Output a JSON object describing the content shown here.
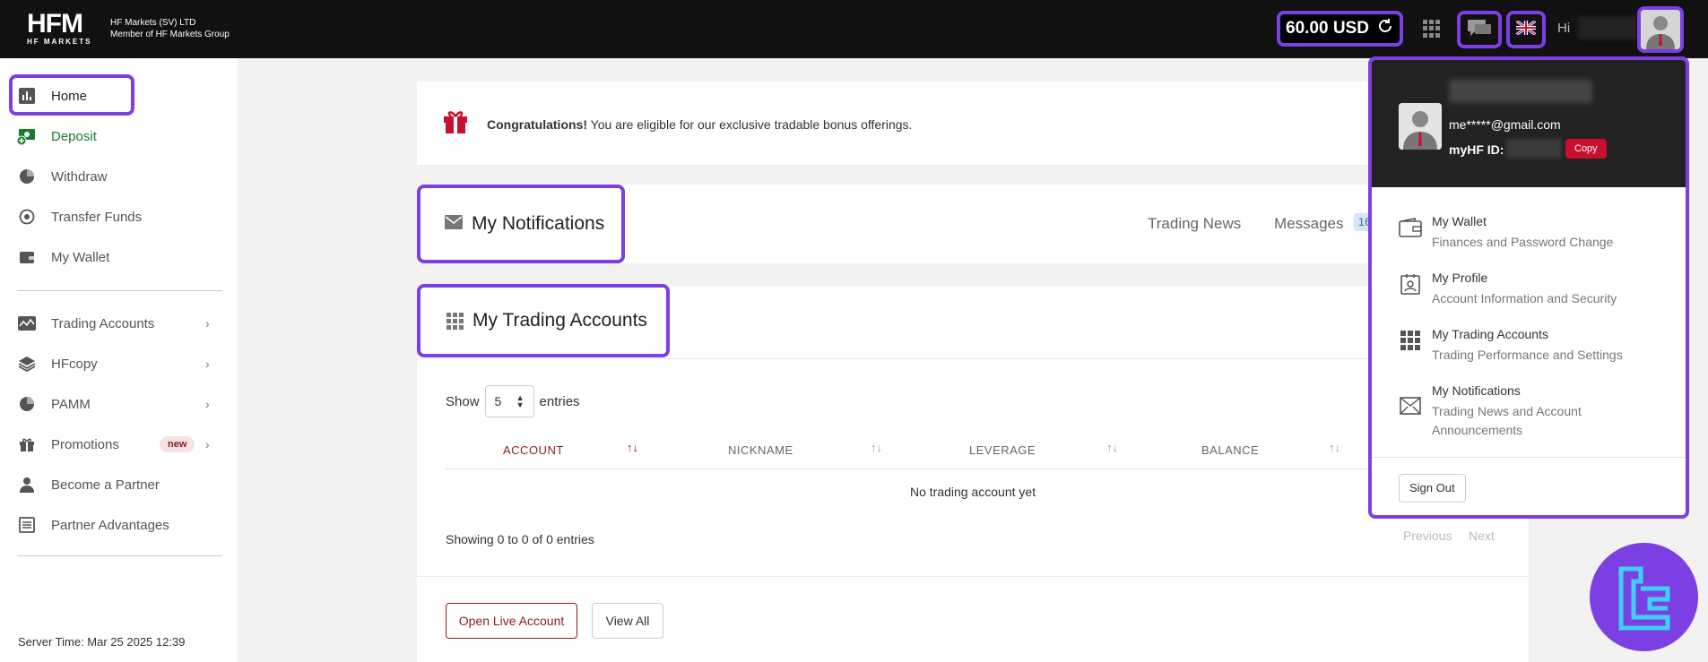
{
  "topbar": {
    "logo_text": "HFM",
    "logo_sub": "HF MARKETS",
    "company_line1": "HF Markets (SV) LTD",
    "company_line2": "Member of HF Markets Group",
    "balance": "60.00 USD",
    "greeting": "Hi"
  },
  "sidebar": {
    "items": [
      {
        "label": "Home"
      },
      {
        "label": "Deposit"
      },
      {
        "label": "Withdraw"
      },
      {
        "label": "Transfer Funds"
      },
      {
        "label": "My Wallet"
      },
      {
        "label": "Trading Accounts"
      },
      {
        "label": "HFcopy"
      },
      {
        "label": "PAMM"
      },
      {
        "label": "Promotions",
        "badge": "new"
      },
      {
        "label": "Become a Partner"
      },
      {
        "label": "Partner Advantages"
      }
    ],
    "server_time": "Server Time: Mar 25 2025 12:39"
  },
  "congrats": {
    "bold": "Congratulations!",
    "text": " You are eligible for our exclusive tradable bonus offerings."
  },
  "notifications": {
    "title": "My Notifications",
    "tab_news": "Trading News",
    "tab_messages": "Messages",
    "messages_count": "16"
  },
  "trading": {
    "title": "My Trading Accounts",
    "show_label": "Show",
    "entries_value": "5",
    "entries_label": "entries",
    "columns": [
      "ACCOUNT",
      "NICKNAME",
      "LEVERAGE",
      "BALANCE"
    ],
    "empty_text": "No trading account yet",
    "showing": "Showing 0 to 0 of 0 entries",
    "previous": "Previous",
    "next": "Next",
    "open_live": "Open Live Account",
    "view_all": "View All"
  },
  "dropdown": {
    "email": "me*****@gmail.com",
    "id_label": "myHF ID:",
    "copy": "Copy",
    "items": [
      {
        "title": "My Wallet",
        "subtitle": "Finances and Password Change"
      },
      {
        "title": "My Profile",
        "subtitle": "Account Information and Security"
      },
      {
        "title": "My Trading Accounts",
        "subtitle": "Trading Performance and Settings"
      },
      {
        "title": "My Notifications",
        "subtitle": "Trading News and Account Announcements"
      }
    ],
    "sign_out": "Sign Out"
  },
  "colors": {
    "highlight": "#7b3fe4",
    "brand_red": "#c8102e",
    "deposit_green": "#1a7a2e"
  }
}
